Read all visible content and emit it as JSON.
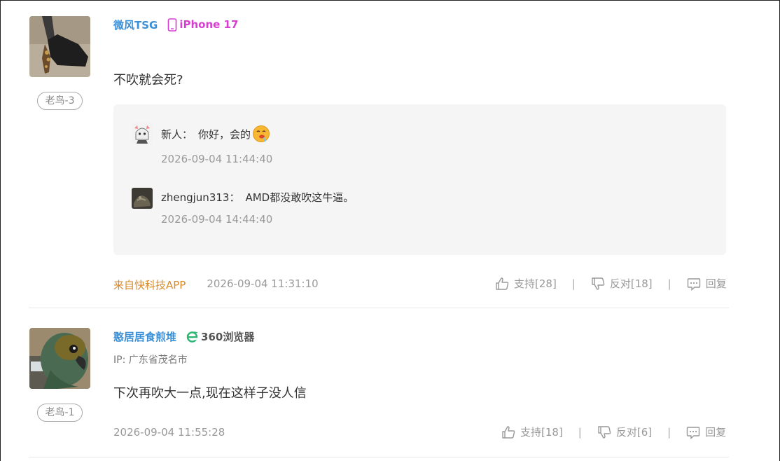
{
  "comments": [
    {
      "username": "微风TSG",
      "device": "iPhone 17",
      "level": "老鸟-3",
      "text": "不吹就会死?",
      "replies": [
        {
          "user": "新人：",
          "text": "你好，会的",
          "emoji": "drooling-face-emoji",
          "time": "2026-09-04 11:44:40"
        },
        {
          "user": "zhengjun313：",
          "text": "AMD都没敢吹这牛逼。",
          "time": "2026-09-04 14:44:40"
        }
      ],
      "source": "来自快科技APP",
      "time": "2026-09-04 11:31:10",
      "support": "支持[28]",
      "oppose": "反对[18]",
      "reply_label": "回复"
    },
    {
      "username": "憨居居食煎堆",
      "browser": "360浏览器",
      "ip": "IP: 广东省茂名市",
      "level": "老鸟-1",
      "text": "下次再吹大一点,现在这样子没人信",
      "time": "2026-09-04 11:55:28",
      "support": "支持[18]",
      "oppose": "反对[6]",
      "reply_label": "回复"
    }
  ],
  "separator": "|",
  "colors": {
    "username": "#3a8fd6",
    "device": "#d63fd0",
    "source": "#d98a29"
  },
  "icons": [
    "thumbs-up-icon",
    "thumbs-down-icon",
    "comment-icon",
    "phone-icon",
    "ie-browser-icon"
  ]
}
